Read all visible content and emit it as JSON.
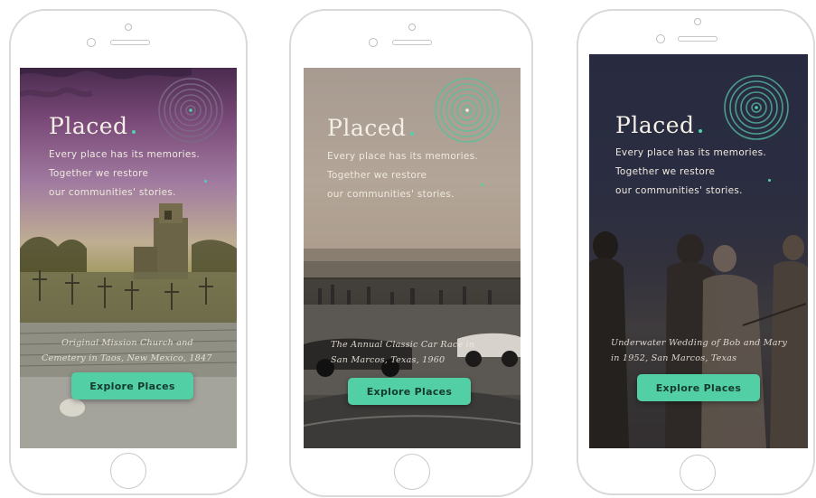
{
  "colors": {
    "accent": "#52cfa5",
    "button_text": "#153a30",
    "title_text": "#f4efe6"
  },
  "screens": [
    {
      "title": "Placed",
      "tagline": [
        "Every place has its memories.",
        "Together we restore",
        "our communities' stories."
      ],
      "caption": [
        "Original Mission Church and",
        "Cemetery in Taos, New Mexico, 1847"
      ],
      "button": "Explore Places"
    },
    {
      "title": "Placed",
      "tagline": [
        "Every place has its memories.",
        "Together we restore",
        "our communities' stories."
      ],
      "caption": [
        "The Annual Classic Car Race in",
        "San Marcos, Texas, 1960"
      ],
      "button": "Explore Places"
    },
    {
      "title": "Placed",
      "tagline": [
        "Every place has its memories.",
        "Together we restore",
        "our communities' stories."
      ],
      "caption": [
        "Underwater Wedding of Bob and Mary",
        "in 1952, San Marcos, Texas"
      ],
      "button": "Explore Places"
    }
  ]
}
